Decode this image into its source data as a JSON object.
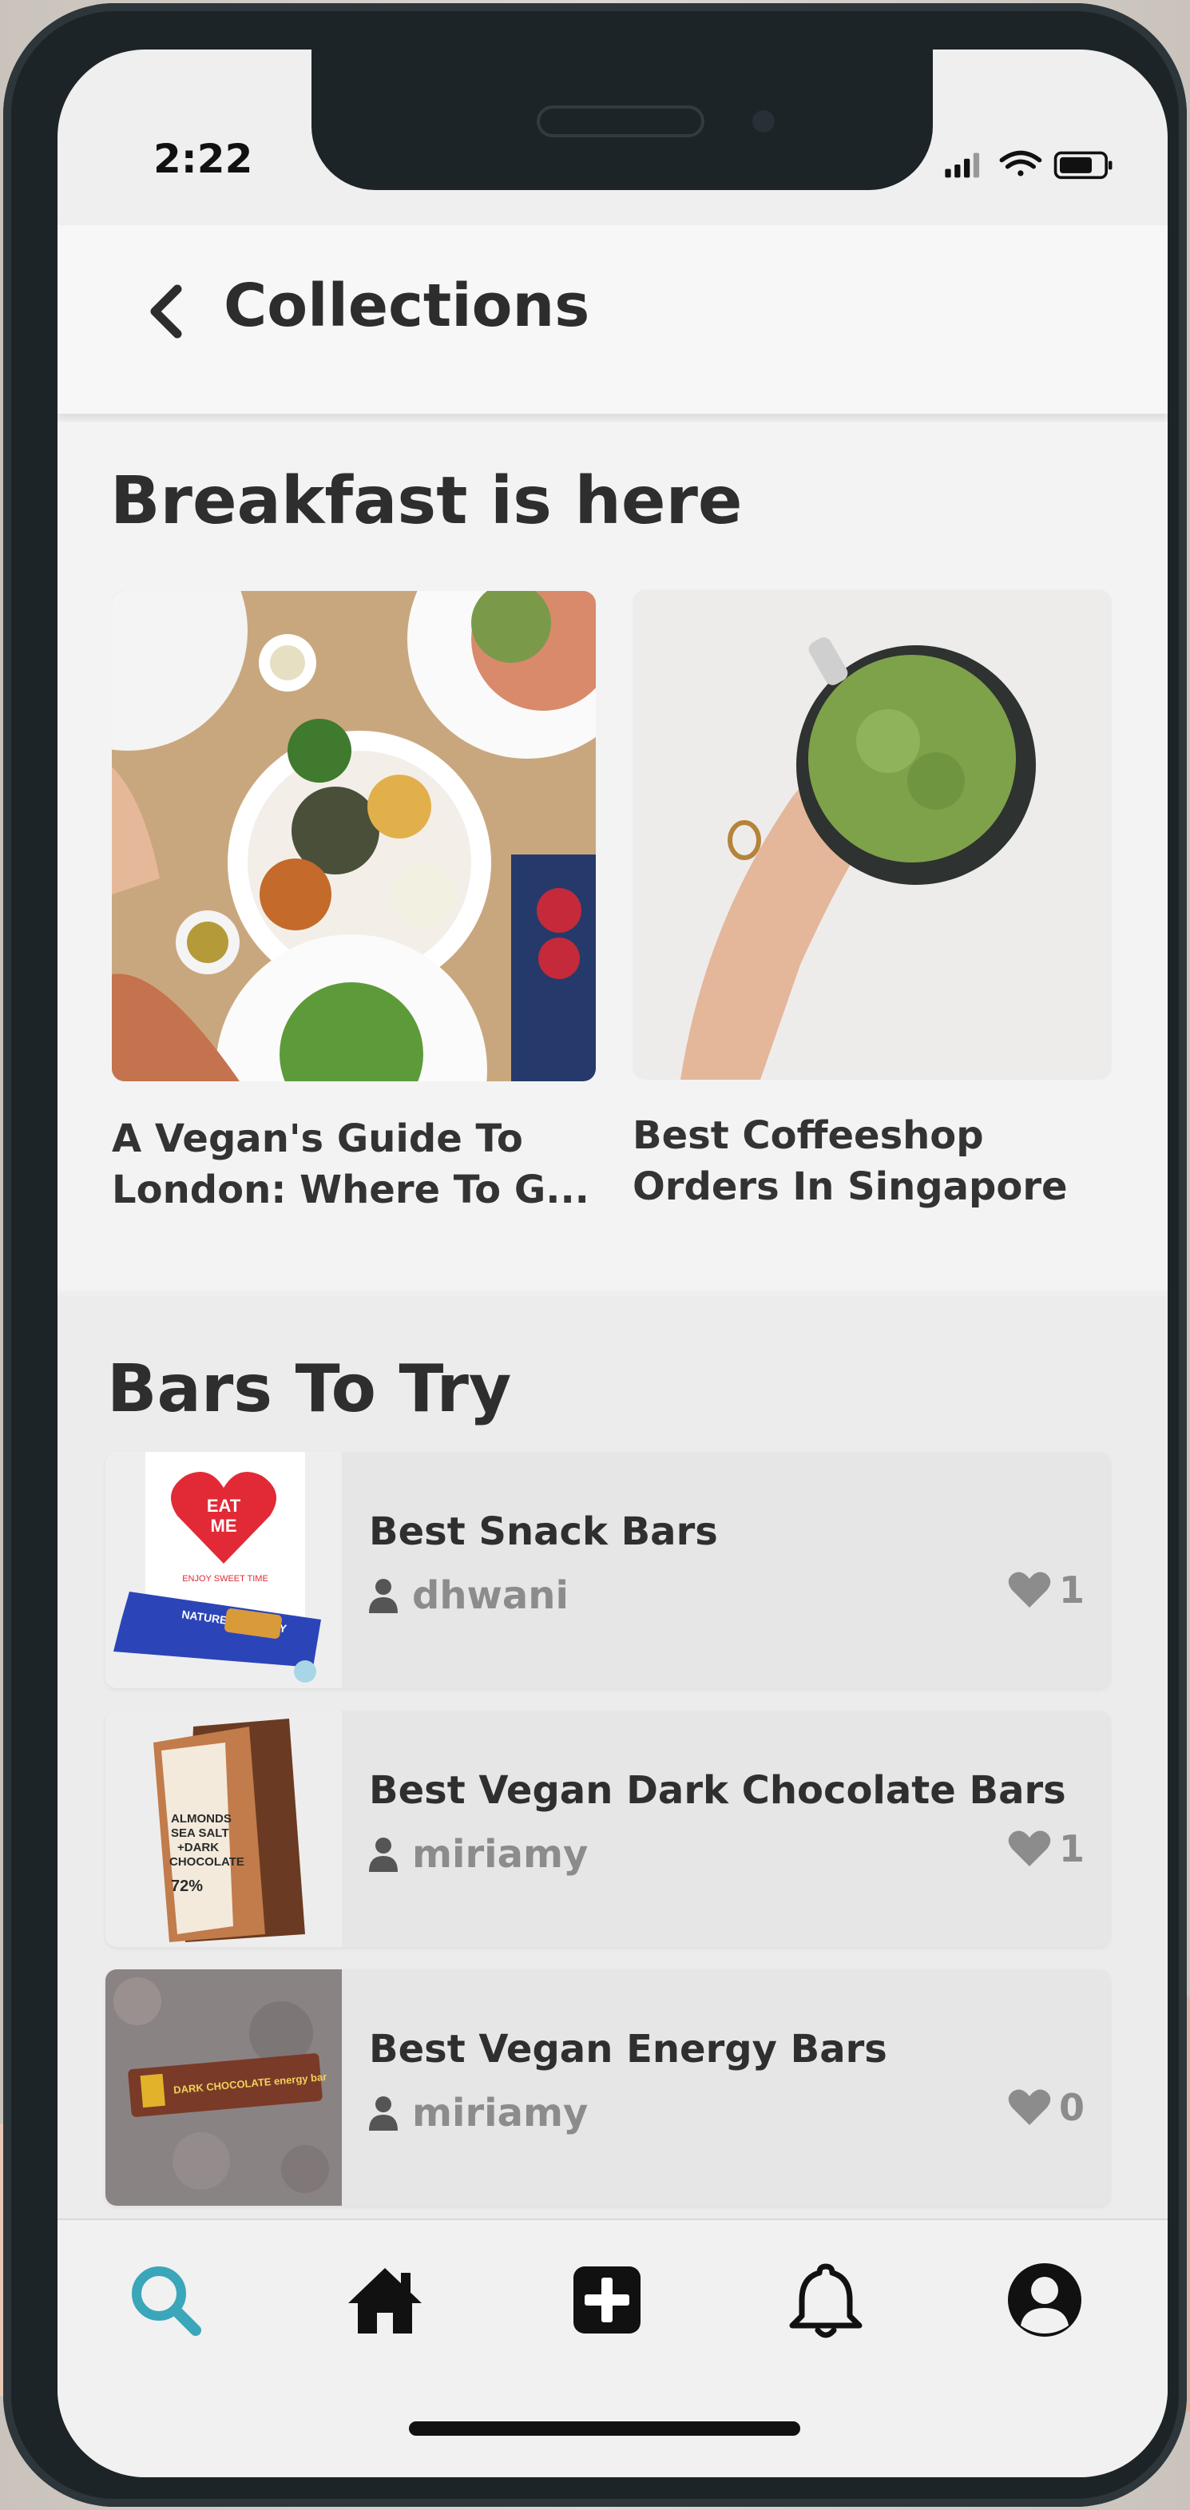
{
  "status_bar": {
    "time": "2:22"
  },
  "header": {
    "back_icon": "chevron-left-icon",
    "title": "Collections"
  },
  "breakfast": {
    "title": "Breakfast is here",
    "cards": [
      {
        "title_line1": "A Vegan's Guide To",
        "title_line2": "London: Where To G..."
      },
      {
        "title_line1": "Best Coffeeshop",
        "title_line2": "Orders In Singapore"
      }
    ]
  },
  "bars": {
    "title": "Bars To Try",
    "items": [
      {
        "title": "Best Snack Bars",
        "author": "dhwani",
        "likes": "1",
        "thumb": {
          "heart_line1": "EAT",
          "heart_line2": "ME",
          "caption": "ENJOY SWEET TIME",
          "brand": "NATURE'S BAKERY"
        }
      },
      {
        "title": "Best Vegan Dark Chocolate Bars",
        "author": "miriamy",
        "likes": "1",
        "thumb": {
          "line1": "ALMONDS",
          "line2": "SEA SALT",
          "line3": "+DARK",
          "line4": "CHOCOLATE",
          "pct": "72%"
        }
      },
      {
        "title": "Best Vegan Energy Bars",
        "author": "miriamy",
        "likes": "0",
        "thumb": {
          "label": "DARK CHOCOLATE energy bar"
        }
      }
    ]
  },
  "nav": {
    "items": [
      "search-icon",
      "home-icon",
      "add-icon",
      "bell-icon",
      "profile-icon"
    ],
    "active": "search-icon",
    "accent": "#3aa6b9"
  }
}
